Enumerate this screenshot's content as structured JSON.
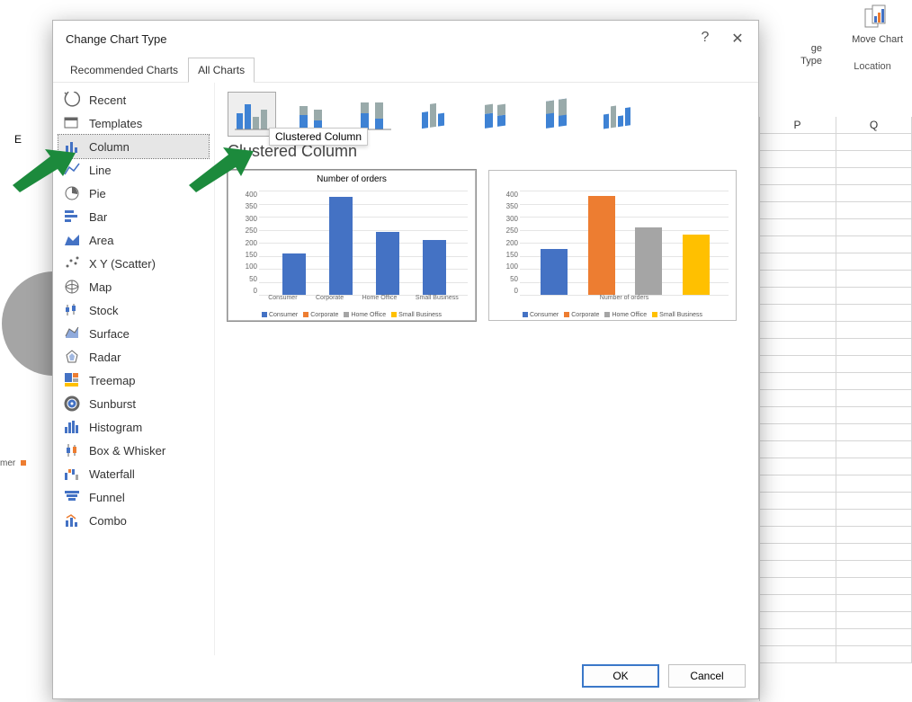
{
  "dialog": {
    "title": "Change Chart Type",
    "tabs": {
      "recommended": "Recommended Charts",
      "all": "All Charts"
    },
    "chart_categories": [
      "Recent",
      "Templates",
      "Column",
      "Line",
      "Pie",
      "Bar",
      "Area",
      "X Y (Scatter)",
      "Map",
      "Stock",
      "Surface",
      "Radar",
      "Treemap",
      "Sunburst",
      "Histogram",
      "Box & Whisker",
      "Waterfall",
      "Funnel",
      "Combo"
    ],
    "selected_category": "Column",
    "subtype_tooltip": "Clustered Column",
    "section_title": "Clustered Column",
    "buttons": {
      "ok": "OK",
      "cancel": "Cancel"
    }
  },
  "ribbon": {
    "type_label": "Type",
    "ge_label": "ge",
    "move_chart": "Move\nChart",
    "location": "Location"
  },
  "columns": {
    "p": "P",
    "q": "Q",
    "e": "E"
  },
  "left_fragment": "mer",
  "chart_data": [
    {
      "type": "bar",
      "title": "Number of orders",
      "categories": [
        "Consumer",
        "Corporate",
        "Home Office",
        "Small Business"
      ],
      "values": [
        160,
        375,
        240,
        210
      ],
      "ylim": [
        0,
        400
      ],
      "ytick": 50,
      "legend": [
        "Consumer",
        "Corporate",
        "Home Office",
        "Small Business"
      ],
      "colors": [
        "#4472C4",
        "#4472C4",
        "#4472C4",
        "#4472C4"
      ],
      "legend_colors": [
        "#4472C4",
        "#ED7D31",
        "#A5A5A5",
        "#FFC000"
      ],
      "xlabel": "Number of orders"
    },
    {
      "type": "bar",
      "title": "",
      "categories": [
        "Consumer",
        "Corporate",
        "Home Office",
        "Small Business"
      ],
      "values": [
        175,
        380,
        260,
        230
      ],
      "ylim": [
        0,
        400
      ],
      "ytick": 50,
      "legend": [
        "Consumer",
        "Corporate",
        "Home Office",
        "Small Business"
      ],
      "colors": [
        "#4472C4",
        "#ED7D31",
        "#A5A5A5",
        "#FFC000"
      ],
      "legend_colors": [
        "#4472C4",
        "#ED7D31",
        "#A5A5A5",
        "#FFC000"
      ],
      "xlabel": "Number of orders"
    }
  ]
}
